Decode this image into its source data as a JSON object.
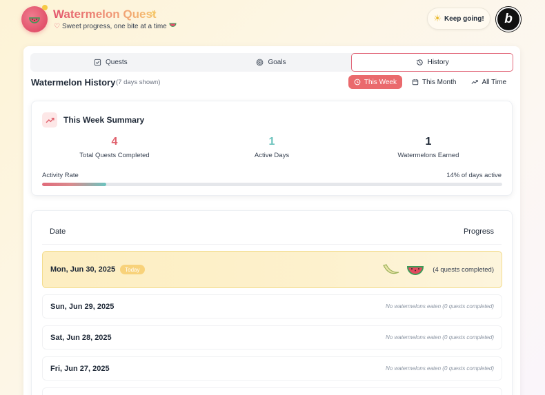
{
  "app": {
    "title": "Watermelon Quest",
    "subtitle": "Sweet progress, one bite at a time",
    "keep_going": "Keep going!",
    "badge_letter": "b"
  },
  "tabs": [
    {
      "label": "Quests",
      "icon": "checkbox-icon",
      "active": false
    },
    {
      "label": "Goals",
      "icon": "target-icon",
      "active": false
    },
    {
      "label": "History",
      "icon": "history-icon",
      "active": true
    }
  ],
  "history": {
    "title": "Watermelon History",
    "note": "(7 days shown)",
    "ranges": [
      {
        "label": "This Week",
        "icon": "clock-icon",
        "active": true
      },
      {
        "label": "This Month",
        "icon": "calendar-icon",
        "active": false
      },
      {
        "label": "All Time",
        "icon": "trending-up-icon",
        "active": false
      }
    ]
  },
  "summary": {
    "title": "This Week Summary",
    "stats": [
      {
        "value": "4",
        "label": "Total Quests Completed",
        "color": "#e0606c"
      },
      {
        "value": "1",
        "label": "Active Days",
        "color": "#6cc3bd"
      },
      {
        "value": "1",
        "label": "Watermelons Earned",
        "color": "#1f2937"
      }
    ],
    "rate_label": "Activity Rate",
    "rate_value": "14% of days active",
    "rate_fraction": 0.14
  },
  "table": {
    "col_date": "Date",
    "col_progress": "Progress",
    "today_badge": "Today",
    "rows": [
      {
        "date": "Mon, Jun 30, 2025",
        "today": true,
        "status": "(4 quests completed)"
      },
      {
        "date": "Sun, Jun 29, 2025",
        "today": false,
        "status": "No watermelons eaten (0 quests completed)"
      },
      {
        "date": "Sat, Jun 28, 2025",
        "today": false,
        "status": "No watermelons eaten (0 quests completed)"
      },
      {
        "date": "Fri, Jun 27, 2025",
        "today": false,
        "status": "No watermelons eaten (0 quests completed)"
      }
    ]
  },
  "colors": {
    "accent": "#ea6a6d",
    "teal": "#6cc3bd",
    "today_bg": "#fdeec1"
  }
}
